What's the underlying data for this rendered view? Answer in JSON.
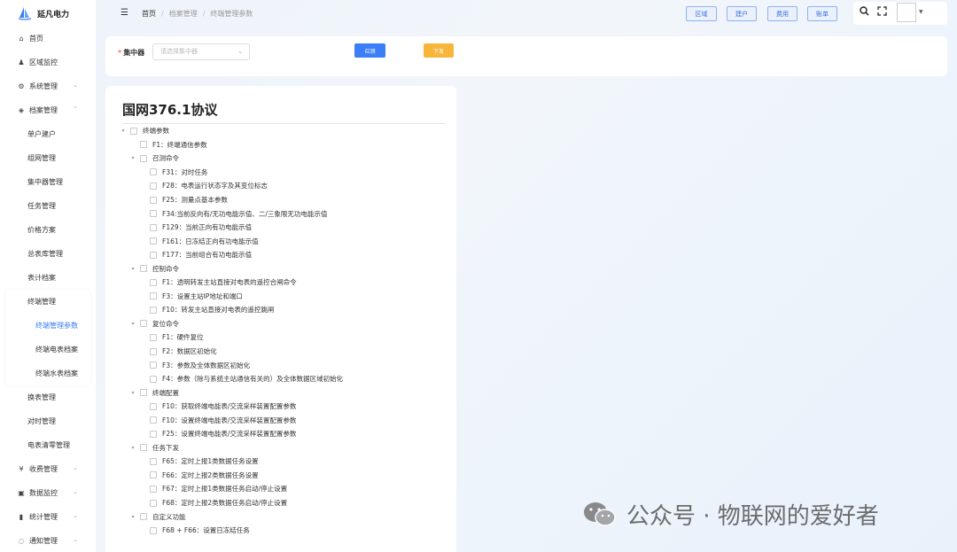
{
  "brand": {
    "name": "延凡电力"
  },
  "sidebar": {
    "items": [
      {
        "icon": "⌂",
        "label": "首页",
        "chevron": ""
      },
      {
        "icon": "♟",
        "label": "区域监控",
        "chevron": ""
      },
      {
        "icon": "⚙",
        "label": "系统管理",
        "chevron": "⌄"
      },
      {
        "icon": "◈",
        "label": "档案管理",
        "chevron": "⌃"
      }
    ],
    "archive_sub": [
      "单户建户",
      "组网管理",
      "集中器管理",
      "任务管理",
      "价格方案",
      "总表库管理",
      "表计档案"
    ],
    "terminal_group": {
      "label": "终端管理",
      "children": [
        "终端管理参数",
        "终端电表档案",
        "终端水表档案"
      ]
    },
    "archive_sub2": [
      "换表管理",
      "对时管理",
      "电表清零管理"
    ],
    "items2": [
      {
        "icon": "¥",
        "label": "收费管理",
        "chevron": "⌄"
      },
      {
        "icon": "▣",
        "label": "数据监控",
        "chevron": "⌄"
      },
      {
        "icon": "▮",
        "label": "统计管理",
        "chevron": "⌄"
      },
      {
        "icon": "◌",
        "label": "通知管理",
        "chevron": "⌄"
      }
    ]
  },
  "header": {
    "breadcrumb": [
      "首页",
      "档案管理",
      "终端管理参数"
    ],
    "buttons": [
      "区域",
      "建户",
      "费用",
      "账单"
    ]
  },
  "query": {
    "label": "集中器",
    "placeholder": "请选择集中器",
    "call_btn": "召测",
    "send_btn": "下发"
  },
  "tree": {
    "title": "国网376.1协议",
    "rows": [
      {
        "level": 0,
        "toggle": "▾",
        "text": "终端参数"
      },
      {
        "level": 1,
        "toggle": "",
        "text": "F1：终端通信参数"
      },
      {
        "level": 1,
        "toggle": "▾",
        "text": "召测命令"
      },
      {
        "level": 2,
        "toggle": "",
        "text": "F31：对时任务"
      },
      {
        "level": 2,
        "toggle": "",
        "text": "F28：电表运行状态字及其变位标志"
      },
      {
        "level": 2,
        "toggle": "",
        "text": "F25：测量点基本参数"
      },
      {
        "level": 2,
        "toggle": "",
        "text": "F34:当前反向有/无功电能示值、二/三象限无功电能示值"
      },
      {
        "level": 2,
        "toggle": "",
        "text": "F129：当前正向有功电能示值"
      },
      {
        "level": 2,
        "toggle": "",
        "text": "F161：日冻结正向有功电能示值"
      },
      {
        "level": 2,
        "toggle": "",
        "text": "F177：当前组合有功电能示值"
      },
      {
        "level": 1,
        "toggle": "▾",
        "text": "控制命令"
      },
      {
        "level": 2,
        "toggle": "",
        "text": "F1：透明转发主站直接对电表的遥控合闸命令"
      },
      {
        "level": 2,
        "toggle": "",
        "text": "F3：设置主站IP地址和端口"
      },
      {
        "level": 2,
        "toggle": "",
        "text": "F10：转发主站直接对电表的遥控跳闸"
      },
      {
        "level": 1,
        "toggle": "▾",
        "text": "复位命令"
      },
      {
        "level": 2,
        "toggle": "",
        "text": "F1：硬件复位"
      },
      {
        "level": 2,
        "toggle": "",
        "text": "F2：数据区初始化"
      },
      {
        "level": 2,
        "toggle": "",
        "text": "F3：参数及全体数据区初始化"
      },
      {
        "level": 2,
        "toggle": "",
        "text": "F4：参数（除与系统主站通信有关的）及全体数据区域初始化"
      },
      {
        "level": 1,
        "toggle": "▾",
        "text": "终端配置"
      },
      {
        "level": 2,
        "toggle": "",
        "text": "F10：获取终端电能表/交流采样装置配置参数"
      },
      {
        "level": 2,
        "toggle": "",
        "text": "F10：设置终端电能表/交流采样装置配置参数"
      },
      {
        "level": 2,
        "toggle": "",
        "text": "F25：设置终端电能表/交流采样装置配置参数"
      },
      {
        "level": 1,
        "toggle": "▾",
        "text": "任务下发"
      },
      {
        "level": 2,
        "toggle": "",
        "text": "F65：定时上报1类数据任务设置"
      },
      {
        "level": 2,
        "toggle": "",
        "text": "F66：定时上报2类数据任务设置"
      },
      {
        "level": 2,
        "toggle": "",
        "text": "F67：定时上报1类数据任务启动/停止设置"
      },
      {
        "level": 2,
        "toggle": "",
        "text": "F68：定时上报2类数据任务启动/停止设置"
      },
      {
        "level": 1,
        "toggle": "▾",
        "text": "自定义功能"
      },
      {
        "level": 2,
        "toggle": "",
        "text": "F68 + F66：设置日冻结任务"
      }
    ]
  },
  "watermark": {
    "text": "公众号 · 物联网的爱好者"
  },
  "colors": {
    "accent": "#3b7ef7",
    "warning": "#f7b63a"
  }
}
